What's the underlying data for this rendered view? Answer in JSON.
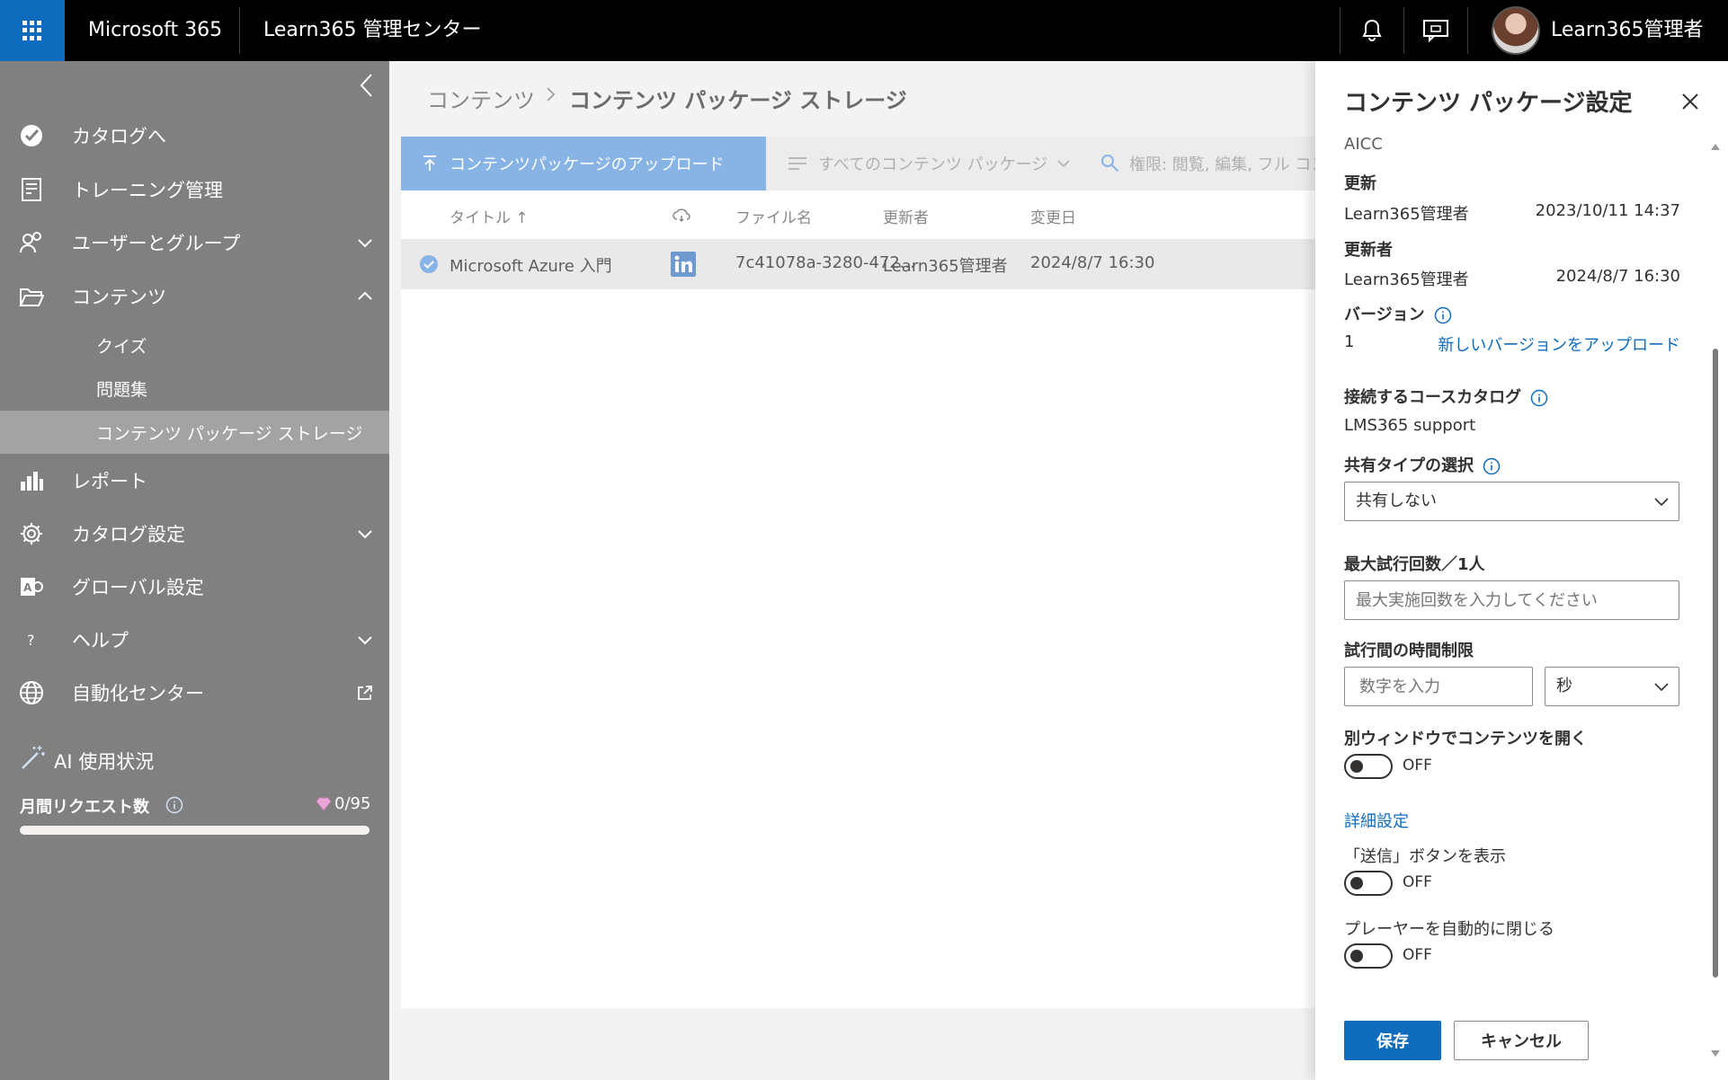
{
  "topbar": {
    "brand": "Microsoft 365",
    "app_name": "Learn365 管理センター",
    "user_name": "Learn365管理者"
  },
  "sidebar": {
    "items": [
      {
        "label": "カタログへ",
        "icon": "catalog-check-icon"
      },
      {
        "label": "トレーニング管理",
        "icon": "training-icon"
      },
      {
        "label": "ユーザーとグループ",
        "icon": "users-icon"
      },
      {
        "label": "コンテンツ",
        "icon": "folder-open-icon"
      },
      {
        "label": "レポート",
        "icon": "bar-chart-icon"
      },
      {
        "label": "カタログ設定",
        "icon": "gear-icon"
      },
      {
        "label": "グローバル設定",
        "icon": "global-settings-icon"
      },
      {
        "label": "ヘルプ",
        "icon": "help-icon"
      },
      {
        "label": "自動化センター",
        "icon": "globe-icon"
      }
    ],
    "sub_items": [
      {
        "label": "クイズ"
      },
      {
        "label": "問題集"
      },
      {
        "label": "コンテンツ パッケージ ストレージ"
      }
    ],
    "ai": {
      "title": "AI 使用状況",
      "requests_label": "月間リクエスト数",
      "requests_count": "0/95",
      "progress": 0
    }
  },
  "main": {
    "breadcrumb_root": "コンテンツ",
    "breadcrumb_current": "コンテンツ パッケージ ストレージ",
    "upload_label": "コンテンツパッケージのアップロード",
    "filter_label": "すべてのコンテンツ パッケージ",
    "search_placeholder": "権限: 閲覧, 編集, フル コントロール",
    "columns": {
      "title": "タイトル",
      "file": "ファイル名",
      "updater": "更新者",
      "date": "変更日"
    },
    "rows": [
      {
        "title": "Microsoft Azure 入門",
        "file": "7c41078a-3280-472...",
        "updater": "Learn365管理者",
        "date": "2024/8/7 16:30"
      }
    ]
  },
  "panel": {
    "title": "コンテンツ パッケージ設定",
    "type_value": "AICC",
    "updated_label": "更新",
    "updated_by": "Learn365管理者",
    "updated_date": "2023/10/11 14:37",
    "updater_label": "更新者",
    "updater_name": "Learn365管理者",
    "updater_date": "2024/8/7 16:30",
    "version_label": "バージョン",
    "version_value": "1",
    "version_link": "新しいバージョンをアップロード",
    "catalog_label": "接続するコースカタログ",
    "catalog_value": "LMS365 support",
    "share_label": "共有タイプの選択",
    "share_value": "共有しない",
    "max_attempts_label": "最大試行回数／1人",
    "max_attempts_placeholder": "最大実施回数を入力してください",
    "time_limit_label": "試行間の時間制限",
    "time_limit_placeholder": "数字を入力",
    "time_unit_value": "秒",
    "new_window_label": "別ウィンドウでコンテンツを開く",
    "toggle_off": "OFF",
    "advanced_link": "詳細設定",
    "submit_button_label": "「送信」ボタンを表示",
    "auto_close_label": "プレーヤーを自動的に閉じる",
    "save": "保存",
    "cancel": "キャンセル"
  }
}
